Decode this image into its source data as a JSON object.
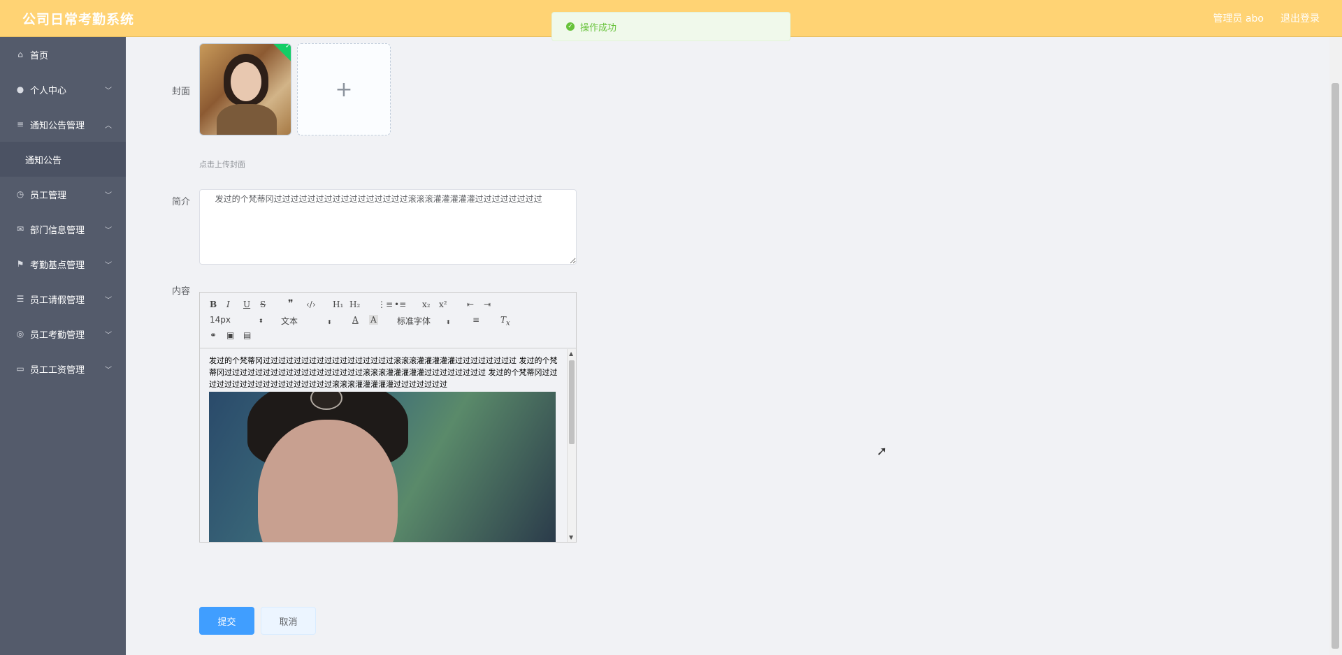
{
  "header": {
    "title": "公司日常考勤系统",
    "user_label": "管理员 abo",
    "logout_label": "退出登录"
  },
  "toast": {
    "message": "操作成功",
    "color": "#67c23a"
  },
  "sidebar": {
    "items": [
      {
        "label": "首页",
        "icon": "home-icon"
      },
      {
        "label": "个人中心",
        "icon": "user-icon"
      },
      {
        "label": "通知公告管理",
        "icon": "list-icon"
      },
      {
        "label": "通知公告",
        "icon": ""
      },
      {
        "label": "员工管理",
        "icon": "clock-icon"
      },
      {
        "label": "部门信息管理",
        "icon": "mail-icon"
      },
      {
        "label": "考勤基点管理",
        "icon": "flag-icon"
      },
      {
        "label": "员工请假管理",
        "icon": "sliders-icon"
      },
      {
        "label": "员工考勤管理",
        "icon": "circle-icon"
      },
      {
        "label": "员工工资管理",
        "icon": "card-icon"
      }
    ]
  },
  "form": {
    "cover_label": "封面",
    "upload_tip": "点击上传封面",
    "intro_label": "简介",
    "intro_value": "  发过的个梵蒂冈过过过过过过过过过过过过过过过过滚滚滚灌灌灌灌灌过过过过过过过过",
    "content_label": "内容",
    "submit_label": "提交",
    "cancel_label": "取消"
  },
  "editor": {
    "font_size": "14px",
    "heading": "文本",
    "font_family": "标准字体",
    "body_text": " 发过的个梵蒂冈过过过过过过过过过过过过过过过过过滚滚滚灌灌灌灌灌过过过过过过过过 发过的个梵蒂冈过过过过过过过过过过过过过过过过过过滚滚滚灌灌灌灌灌过过过过过过过过 发过的个梵蒂冈过过过过过过过过过过过过过过过过过过滚滚滚灌灌灌灌灌过过过过过过过"
  }
}
